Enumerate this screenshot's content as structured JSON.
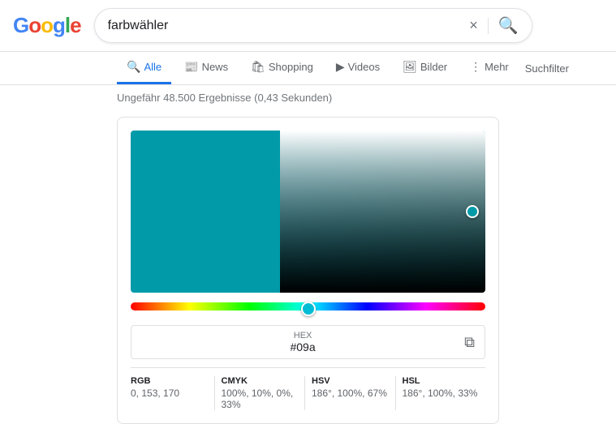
{
  "header": {
    "logo_letters": [
      "G",
      "o",
      "o",
      "g",
      "l",
      "e"
    ],
    "search_value": "farbwähler",
    "clear_label": "×",
    "search_aria": "Suche"
  },
  "nav": {
    "items": [
      {
        "id": "alle",
        "label": "Alle",
        "icon": "🔍",
        "active": true
      },
      {
        "id": "news",
        "label": "News",
        "icon": "📰",
        "active": false
      },
      {
        "id": "shopping",
        "label": "Shopping",
        "icon": "🛍",
        "active": false
      },
      {
        "id": "videos",
        "label": "Videos",
        "icon": "▶",
        "active": false
      },
      {
        "id": "bilder",
        "label": "Bilder",
        "icon": "🖼",
        "active": false
      },
      {
        "id": "mehr",
        "label": "Mehr",
        "icon": "⋮",
        "active": false
      }
    ],
    "filter_label": "Suchfilter"
  },
  "results": {
    "info": "Ungefähr 48.500 Ergebnisse (0,43 Sekunden)"
  },
  "color_picker": {
    "hex_label": "HEX",
    "hex_value": "#09a",
    "copy_icon": "copy",
    "rgb_label": "RGB",
    "rgb_value": "0, 153, 170",
    "cmyk_label": "CMYK",
    "cmyk_value": "100%, 10%, 0%, 33%",
    "hsv_label": "HSV",
    "hsv_value": "186°, 100%, 67%",
    "hsl_label": "HSL",
    "hsl_value": "186°, 100%, 33%"
  }
}
